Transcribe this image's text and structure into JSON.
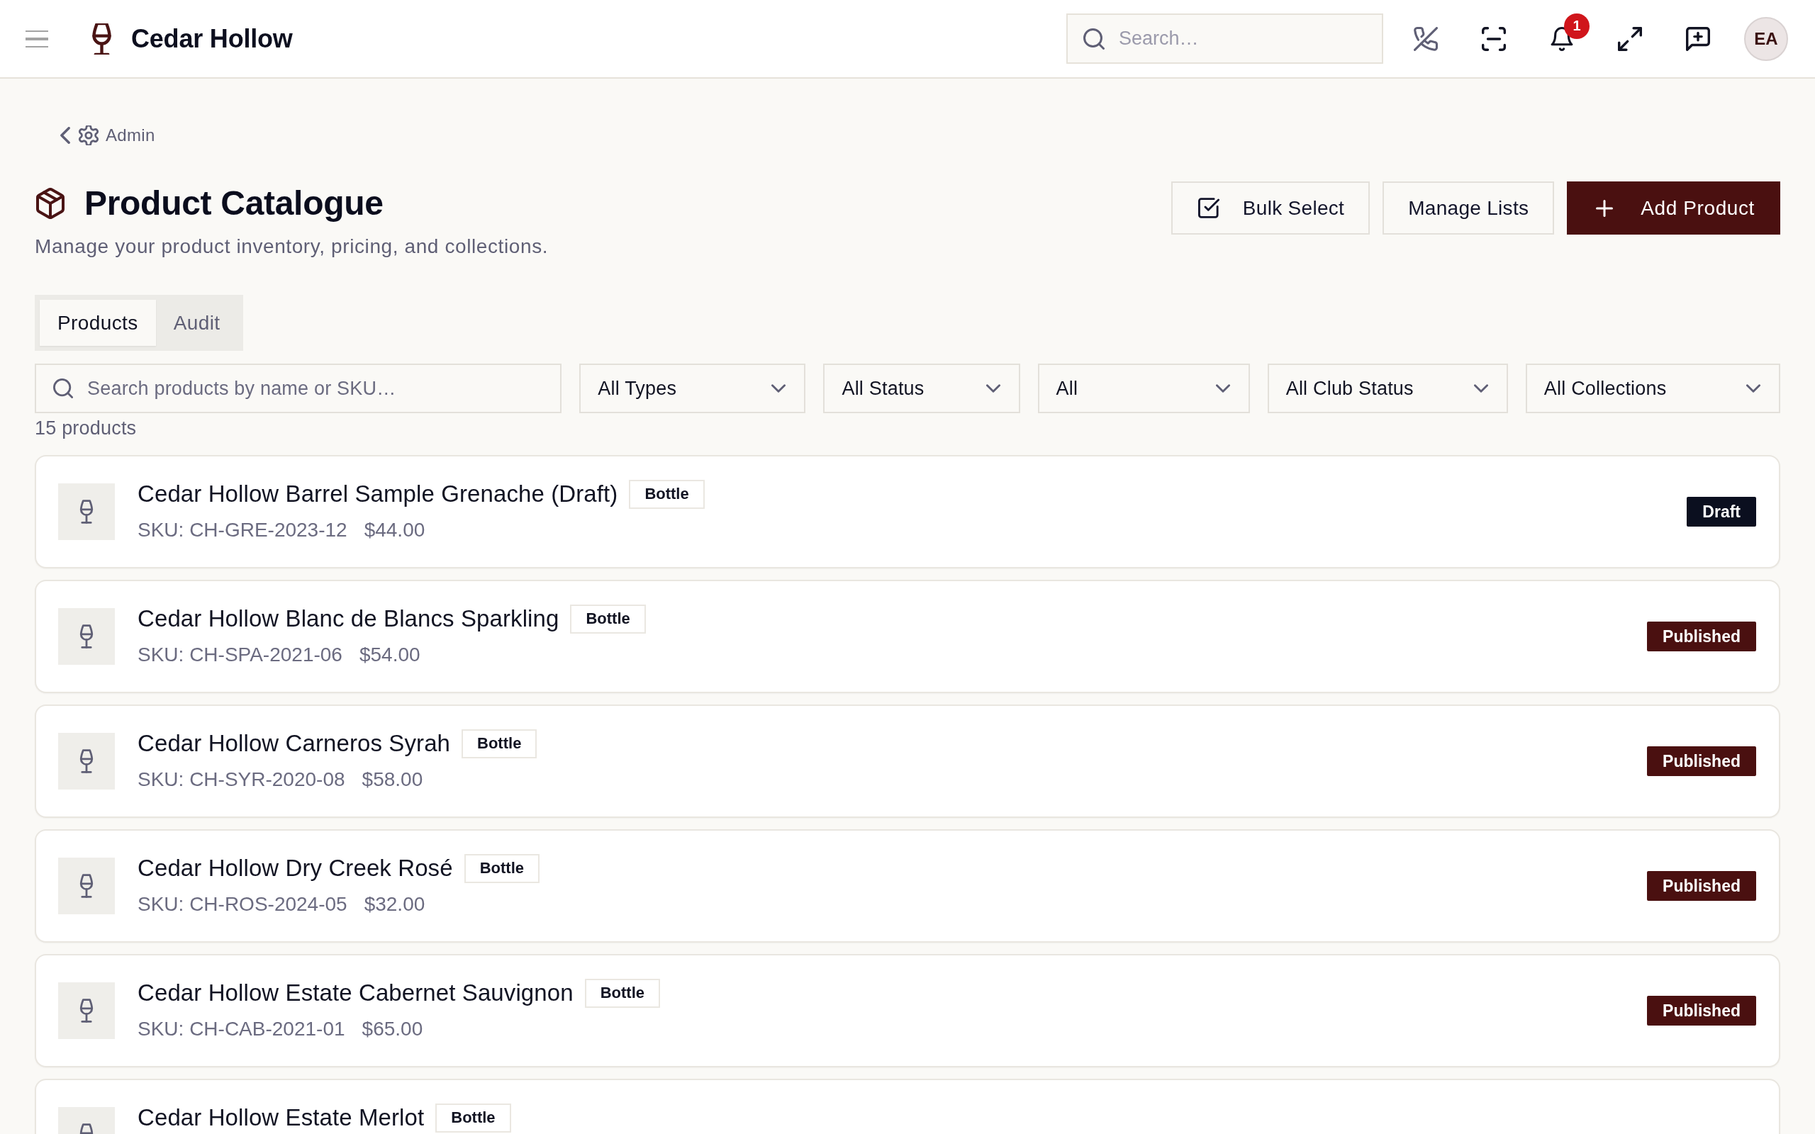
{
  "header": {
    "brand": "Cedar Hollow",
    "search": {
      "placeholder": "Search…"
    },
    "notifications": {
      "count": "1"
    },
    "avatar": {
      "initials": "EA"
    }
  },
  "breadcrumb": {
    "label": "Admin"
  },
  "page": {
    "title": "Product Catalogue",
    "subtitle": "Manage your product inventory, pricing, and collections.",
    "actions": [
      {
        "label": "Bulk Select",
        "kind": "bulk"
      },
      {
        "label": "Manage Lists",
        "kind": "plain"
      },
      {
        "label": "Add Product",
        "kind": "primary"
      }
    ]
  },
  "tabs": [
    {
      "label": "Products",
      "selected": true
    },
    {
      "label": "Audit",
      "selected": false
    }
  ],
  "filters": {
    "search": {
      "placeholder": "Search products by name or SKU…"
    },
    "dropdowns": [
      {
        "value": "All Types"
      },
      {
        "value": "All Status"
      },
      {
        "value": "All"
      },
      {
        "value": "All Club Status"
      },
      {
        "value": "All Collections"
      }
    ]
  },
  "count": "15 products",
  "products": [
    {
      "name": "Cedar Hollow Barrel Sample Grenache (Draft)",
      "type": "Bottle",
      "sku": "SKU: CH-GRE-2023-12",
      "price": "$44.00",
      "status": {
        "label": "Draft",
        "kind": "draft"
      }
    },
    {
      "name": "Cedar Hollow Blanc de Blancs Sparkling",
      "type": "Bottle",
      "sku": "SKU: CH-SPA-2021-06",
      "price": "$54.00",
      "status": {
        "label": "Published",
        "kind": "published"
      }
    },
    {
      "name": "Cedar Hollow Carneros Syrah",
      "type": "Bottle",
      "sku": "SKU: CH-SYR-2020-08",
      "price": "$58.00",
      "status": {
        "label": "Published",
        "kind": "published"
      }
    },
    {
      "name": "Cedar Hollow Dry Creek Rosé",
      "type": "Bottle",
      "sku": "SKU: CH-ROS-2024-05",
      "price": "$32.00",
      "status": {
        "label": "Published",
        "kind": "published"
      }
    },
    {
      "name": "Cedar Hollow Estate Cabernet Sauvignon",
      "type": "Bottle",
      "sku": "SKU: CH-CAB-2021-01",
      "price": "$65.00",
      "status": {
        "label": "Published",
        "kind": "published"
      }
    },
    {
      "name": "Cedar Hollow Estate Merlot",
      "type": "Bottle"
    }
  ]
}
